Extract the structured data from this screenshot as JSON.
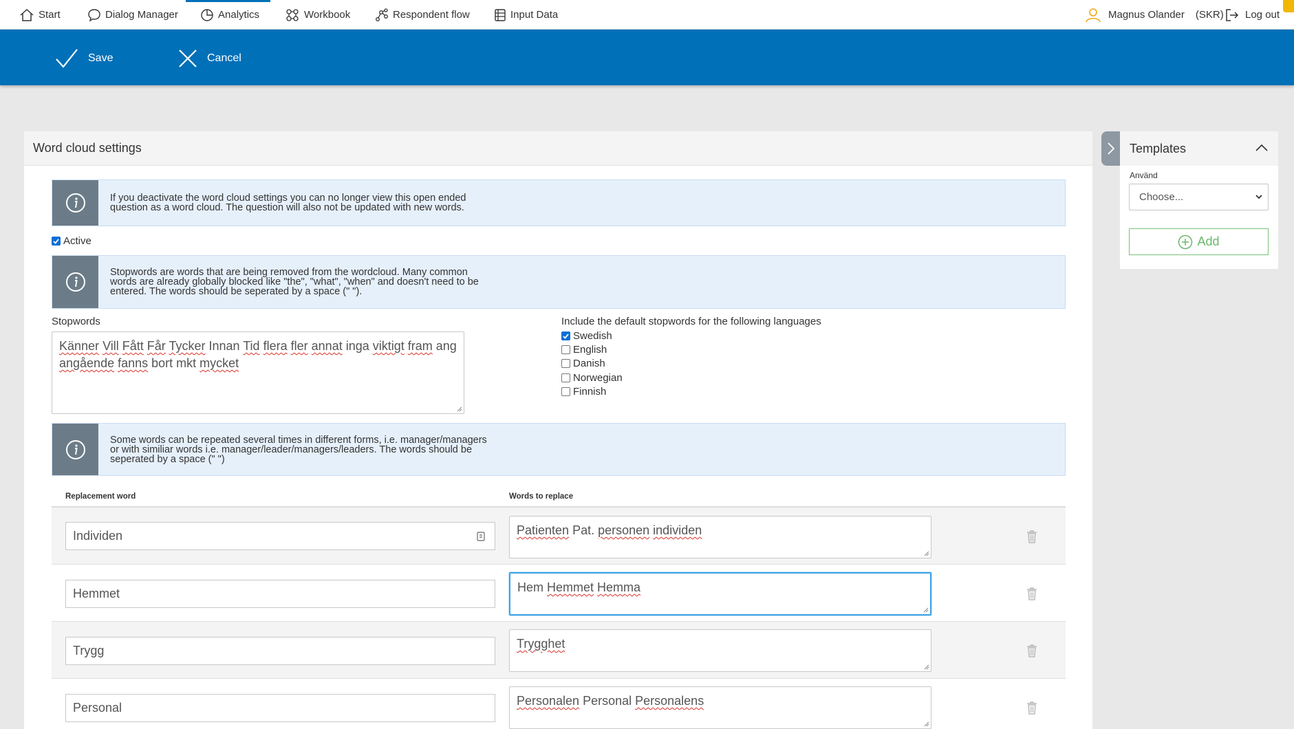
{
  "nav": {
    "items": [
      {
        "label": "Start",
        "icon": "home-icon"
      },
      {
        "label": "Dialog Manager",
        "icon": "chat-bubble-icon"
      },
      {
        "label": "Analytics",
        "icon": "pie-chart-icon"
      },
      {
        "label": "Workbook",
        "icon": "workbook-icon"
      },
      {
        "label": "Respondent flow",
        "icon": "flow-icon"
      },
      {
        "label": "Input Data",
        "icon": "table-icon"
      }
    ],
    "active": "Analytics",
    "user_name": "Magnus Olander",
    "user_org": "(SKR)",
    "logout_label": "Log out"
  },
  "actions": {
    "save_label": "Save",
    "cancel_label": "Cancel"
  },
  "card": {
    "title": "Word cloud settings",
    "info1": "If you deactivate the word cloud settings you can no longer view this open ended question as a word cloud. The question will also not be updated with new words.",
    "active_label": "Active",
    "active_checked": true,
    "info2": "Stopwords are words that are being removed from the wordcloud. Many common words are already globally blocked like \"the\", \"what\", \"when\" and doesn't need to be entered. The words should be seperated by a space (\" \").",
    "stopwords_label": "Stopwords",
    "stopwords_value": "Känner Vill Fått Får Tycker Innan Tid flera fler annat inga viktigt fram ang angående fanns bort mkt mycket",
    "languages_label": "Include the default stopwords for the following languages",
    "languages": [
      {
        "label": "Swedish",
        "checked": true
      },
      {
        "label": "English",
        "checked": false
      },
      {
        "label": "Danish",
        "checked": false
      },
      {
        "label": "Norwegian",
        "checked": false
      },
      {
        "label": "Finnish",
        "checked": false
      }
    ],
    "info3": "Some words can be repeated several times in different forms, i.e. manager/managers or with similiar words i.e. manager/leader/managers/leaders. The words should be seperated by a space (\" \")",
    "col_replacement": "Replacement word",
    "col_words": "Words to replace",
    "rows": [
      {
        "replacement": "Individen",
        "words": "Patienten Pat. personen individen"
      },
      {
        "replacement": "Hemmet",
        "words": "Hem Hemmet Hemma"
      },
      {
        "replacement": "Trygg",
        "words": "Trygghet"
      },
      {
        "replacement": "Personal",
        "words": "Personalen Personal Personalens"
      }
    ]
  },
  "templates": {
    "title": "Templates",
    "use_label": "Använd",
    "select_value": "Choose...",
    "add_label": "Add"
  },
  "colors": {
    "brand_blue": "#0070b8",
    "info_bg": "#e6f0fb",
    "info_icon_bg": "#6b7c88",
    "add_green": "#6cb86c",
    "focus_blue": "#3fa3e6"
  }
}
